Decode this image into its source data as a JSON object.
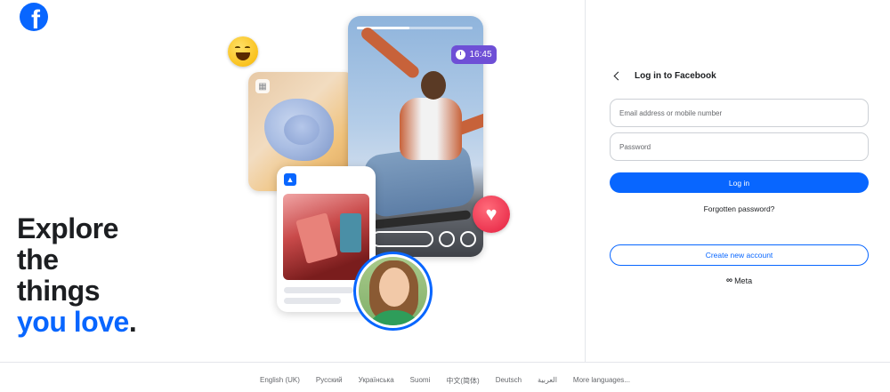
{
  "brand": {
    "logo_letter": "f",
    "accent": "#0866ff"
  },
  "hero": {
    "line1": "Explore",
    "line2": "the",
    "line3": "things",
    "line4_blue": "you love",
    "line4_dot": "."
  },
  "collage": {
    "story_time": "16:45",
    "story_progress": 0.45
  },
  "login": {
    "title": "Log in to Facebook",
    "email_placeholder": "Email address or mobile number",
    "password_placeholder": "Password",
    "login_label": "Log in",
    "forgot_label": "Forgotten password?",
    "create_label": "Create new account",
    "meta_mark": "∞",
    "meta_label": "Meta"
  },
  "footer": {
    "languages": [
      "English (UK)",
      "Русский",
      "Українська",
      "Suomi",
      "中文(简体)",
      "Deutsch",
      "العربية",
      "More languages..."
    ]
  }
}
